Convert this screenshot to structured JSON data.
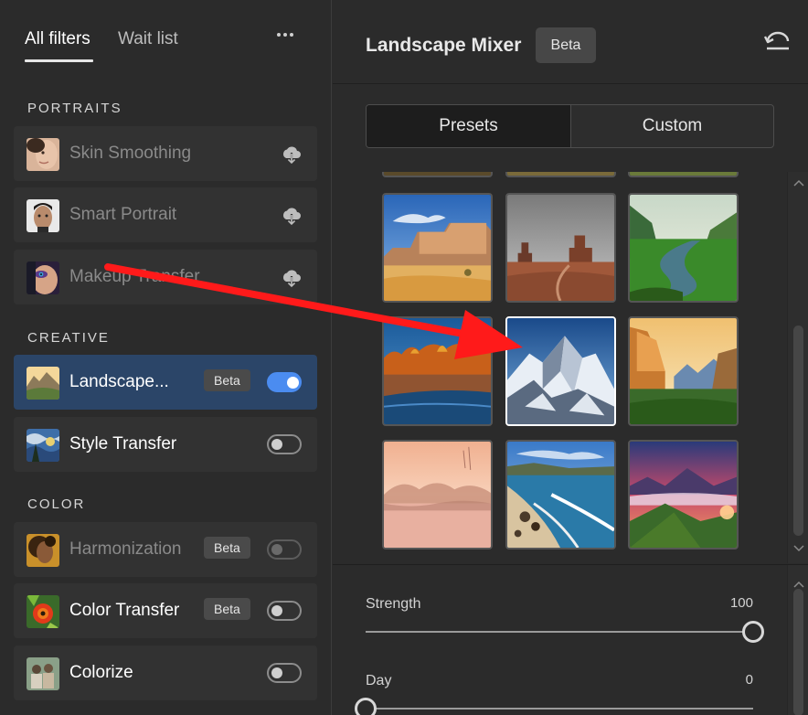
{
  "left_panel": {
    "tabs": [
      {
        "label": "All filters",
        "active": true
      },
      {
        "label": "Wait list",
        "active": false
      }
    ],
    "more_icon": "more-horizontal-icon",
    "sections": {
      "portraits": "PORTRAITS",
      "creative": "CREATIVE",
      "color": "COLOR"
    },
    "portraits": [
      {
        "label": "Skin Smoothing",
        "action_icon": "cloud-download-icon"
      },
      {
        "label": "Smart Portrait",
        "action_icon": "cloud-download-icon"
      },
      {
        "label": "Makeup Transfer",
        "action_icon": "cloud-download-icon"
      }
    ],
    "creative": [
      {
        "label": "Landscape...",
        "badge": "Beta",
        "toggle": "on"
      },
      {
        "label": "Style Transfer",
        "toggle": "off"
      }
    ],
    "color": [
      {
        "label": "Harmonization",
        "badge": "Beta",
        "toggle": "off"
      },
      {
        "label": "Color Transfer",
        "badge": "Beta",
        "toggle": "off"
      },
      {
        "label": "Colorize",
        "toggle": "off"
      }
    ]
  },
  "right_panel": {
    "title": "Landscape Mixer",
    "badge": "Beta",
    "reset_icon": "reset-undo-icon",
    "segments": [
      {
        "label": "Presets",
        "active": true
      },
      {
        "label": "Custom",
        "active": false
      }
    ],
    "presets": [
      {
        "name": "desert-mesa"
      },
      {
        "name": "monument-valley"
      },
      {
        "name": "green-river-valley"
      },
      {
        "name": "autumn-lake"
      },
      {
        "name": "snowy-mountain",
        "selected": true
      },
      {
        "name": "yosemite-valley"
      },
      {
        "name": "misty-pink-lake"
      },
      {
        "name": "rocky-beach"
      },
      {
        "name": "sunset-peaks"
      }
    ],
    "sliders": [
      {
        "label": "Strength",
        "value": "100",
        "fraction": 1.0
      },
      {
        "label": "Day",
        "value": "0",
        "fraction": 0.0
      }
    ]
  },
  "annotation": {
    "type": "red-arrow",
    "color": "#ff1a1a"
  }
}
